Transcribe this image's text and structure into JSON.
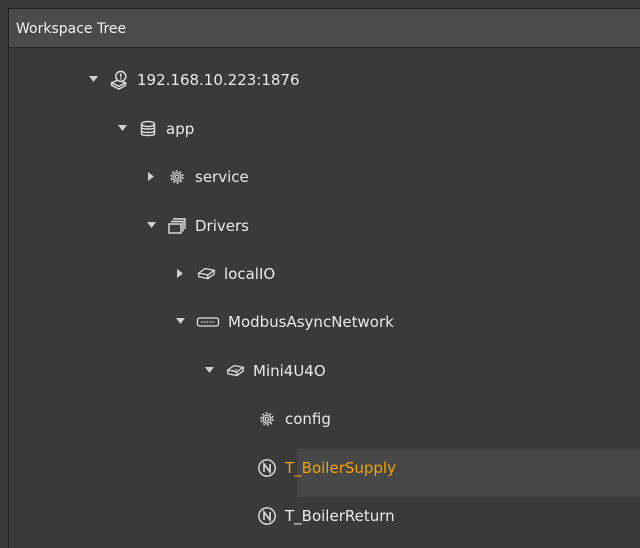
{
  "panel": {
    "title": "Workspace Tree"
  },
  "colors": {
    "background": "#3a3a3a",
    "header": "#4b4b4b",
    "text": "#e9e9e9",
    "selected_text": "#f0a500"
  },
  "tree": [
    {
      "label": "192.168.10.223:1876",
      "icon": "station-warning-icon",
      "expanded": true
    },
    {
      "label": "app",
      "icon": "database-icon",
      "expanded": true
    },
    {
      "label": "service",
      "icon": "gear-icon",
      "expanded": false
    },
    {
      "label": "Drivers",
      "icon": "folder-stack-icon",
      "expanded": true
    },
    {
      "label": "localIO",
      "icon": "device-icon",
      "expanded": false
    },
    {
      "label": "ModbusAsyncNetwork",
      "icon": "network-connector-icon",
      "expanded": true
    },
    {
      "label": "Mini4U4O",
      "icon": "device-icon",
      "expanded": true
    },
    {
      "label": "config",
      "icon": "gear-icon"
    },
    {
      "label": "T_BoilerSupply",
      "icon": "n-circle-icon",
      "selected": true
    },
    {
      "label": "T_BoilerReturn",
      "icon": "n-circle-icon"
    }
  ]
}
